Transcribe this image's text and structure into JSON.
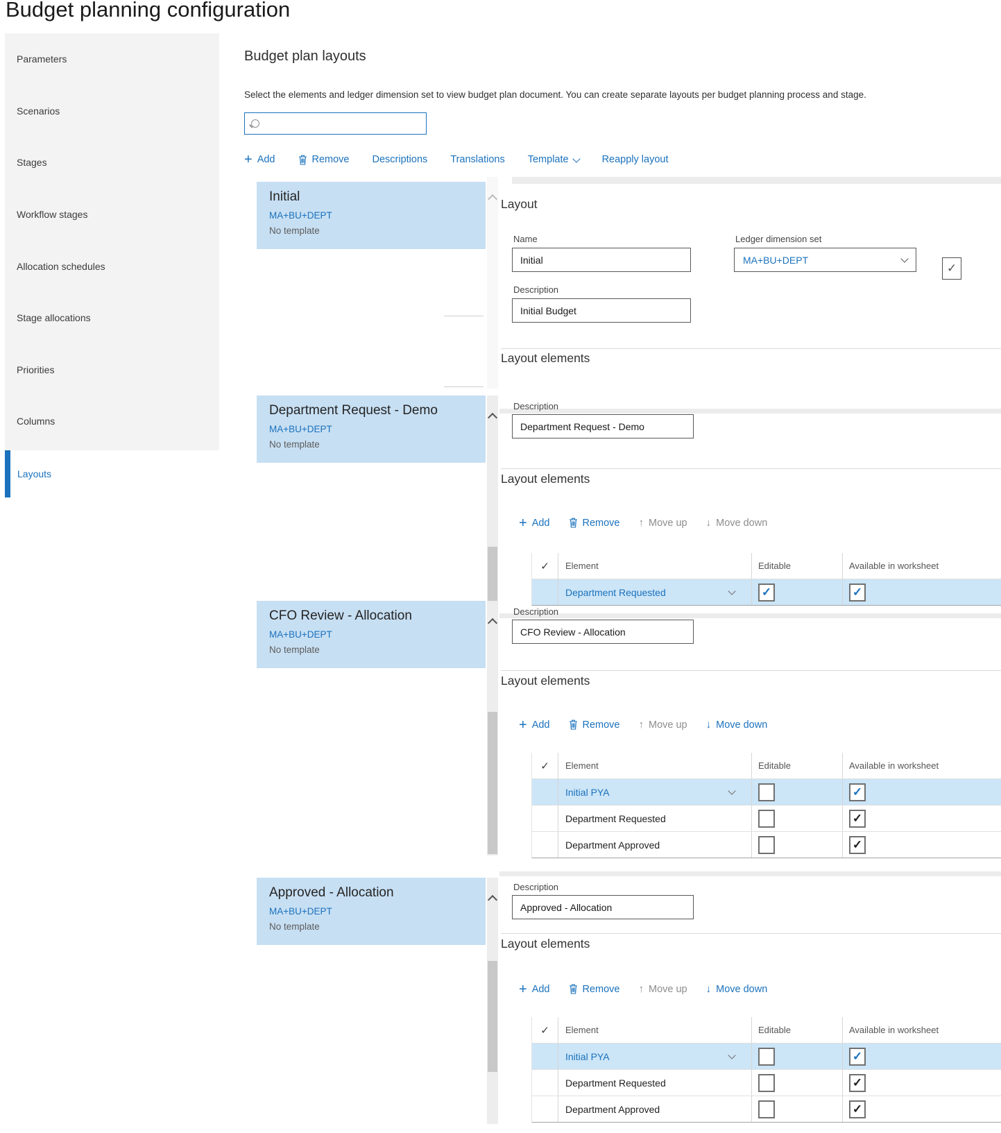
{
  "app": {
    "title": "Budget planning configuration"
  },
  "sidebar": {
    "items": [
      {
        "label": "Parameters",
        "selected": false
      },
      {
        "label": "Scenarios",
        "selected": false
      },
      {
        "label": "Stages",
        "selected": false
      },
      {
        "label": "Workflow stages",
        "selected": false
      },
      {
        "label": "Allocation schedules",
        "selected": false
      },
      {
        "label": "Stage allocations",
        "selected": false
      },
      {
        "label": "Priorities",
        "selected": false
      },
      {
        "label": "Columns",
        "selected": false
      },
      {
        "label": "Layouts",
        "selected": true
      }
    ]
  },
  "main": {
    "heading": "Budget plan layouts",
    "intro": "Select the elements and ledger dimension set to view budget plan document. You can create separate layouts per budget planning process and stage.",
    "search": {
      "value": "",
      "placeholder": ""
    },
    "toolbar": {
      "add": "Add",
      "remove": "Remove",
      "descriptions": "Descriptions",
      "translations": "Translations",
      "template": "Template",
      "reapply_layout": "Reapply layout"
    }
  },
  "colors": {
    "accent": "#1b72bd",
    "card_blue": "#c7dff3",
    "row_selected_blue": "#cce5f7"
  },
  "sections": [
    {
      "card": {
        "title": "Initial",
        "dimension_set": "MA+BU+DEPT",
        "template": "No template"
      },
      "panel": {
        "heading": "Layout",
        "name": {
          "label": "Name",
          "value": "Initial"
        },
        "ledger": {
          "label": "Ledger dimension set",
          "value": "MA+BU+DEPT"
        },
        "side_checkbox": {
          "checked": true
        },
        "description": {
          "label": "Description",
          "value": "Initial Budget"
        },
        "elements_heading": "Layout elements"
      }
    },
    {
      "card": {
        "title": "Department Request - Demo",
        "dimension_set": "MA+BU+DEPT",
        "template": "No template"
      },
      "panel": {
        "description": {
          "label": "Description",
          "value": "Department Request - Demo"
        },
        "elements_heading": "Layout elements",
        "toolbar": {
          "add": "Add",
          "remove": "Remove",
          "move_up": "Move up",
          "move_down": "Move down",
          "move_up_enabled": false,
          "move_down_enabled": false
        },
        "table": {
          "columns": [
            "Element",
            "Editable",
            "Available in worksheet"
          ],
          "rows": [
            {
              "element": "Department Requested",
              "selected": true,
              "editable": true,
              "available": true
            }
          ]
        }
      }
    },
    {
      "card": {
        "title": "CFO Review - Allocation",
        "dimension_set": "MA+BU+DEPT",
        "template": "No template"
      },
      "panel": {
        "description": {
          "label": "Description",
          "value": "CFO Review - Allocation"
        },
        "elements_heading": "Layout elements",
        "toolbar": {
          "add": "Add",
          "remove": "Remove",
          "move_up": "Move up",
          "move_down": "Move down",
          "move_up_enabled": false,
          "move_down_enabled": true
        },
        "table": {
          "columns": [
            "Element",
            "Editable",
            "Available in worksheet"
          ],
          "rows": [
            {
              "element": "Initial PYA",
              "selected": true,
              "editable": false,
              "available": true
            },
            {
              "element": "Department Requested",
              "selected": false,
              "editable": false,
              "available": true
            },
            {
              "element": "Department Approved",
              "selected": false,
              "editable": false,
              "available": true
            }
          ]
        }
      }
    },
    {
      "card": {
        "title": "Approved - Allocation",
        "dimension_set": "MA+BU+DEPT",
        "template": "No template"
      },
      "panel": {
        "description": {
          "label": "Description",
          "value": "Approved - Allocation"
        },
        "elements_heading": "Layout elements",
        "toolbar": {
          "add": "Add",
          "remove": "Remove",
          "move_up": "Move up",
          "move_down": "Move down",
          "move_up_enabled": false,
          "move_down_enabled": true
        },
        "table": {
          "columns": [
            "Element",
            "Editable",
            "Available in worksheet"
          ],
          "rows": [
            {
              "element": "Initial PYA",
              "selected": true,
              "editable": false,
              "available": true
            },
            {
              "element": "Department Requested",
              "selected": false,
              "editable": false,
              "available": true
            },
            {
              "element": "Department Approved",
              "selected": false,
              "editable": false,
              "available": true
            }
          ]
        }
      }
    }
  ]
}
